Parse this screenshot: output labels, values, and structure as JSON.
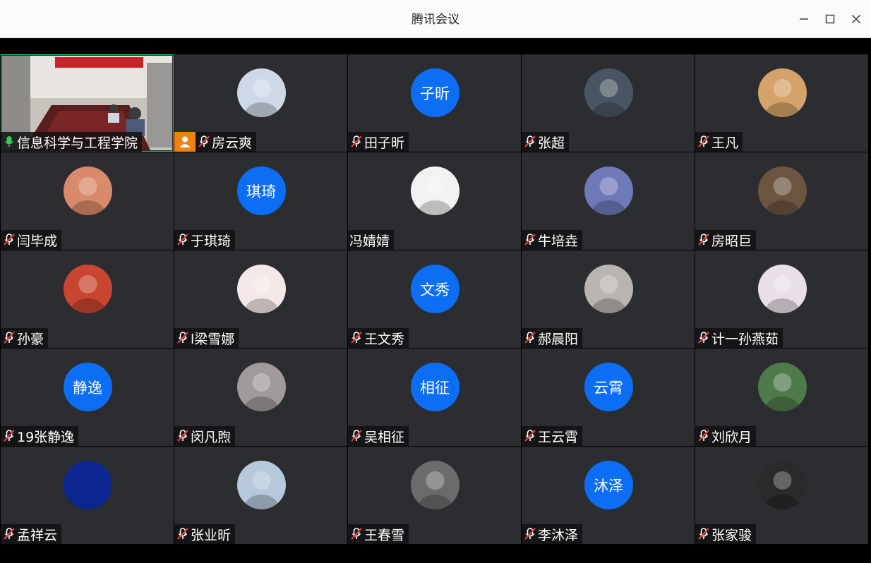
{
  "window": {
    "title": "腾讯会议",
    "controls": [
      "minimize-icon",
      "maximize-icon",
      "close-icon"
    ]
  },
  "participants": [
    {
      "name": "信息科学与工程学院",
      "mic": "on",
      "display": "video",
      "active": true
    },
    {
      "name": "房云爽",
      "mic": "muted",
      "display": "photo",
      "host": true,
      "avatar_color": "#cfd8e6"
    },
    {
      "name": "田子昕",
      "mic": "muted",
      "display": "initials",
      "initials": "子昕"
    },
    {
      "name": "张超",
      "mic": "muted",
      "display": "photo",
      "avatar_color": "#4a5563"
    },
    {
      "name": "王凡",
      "mic": "muted",
      "display": "photo",
      "avatar_color": "#d4a26a"
    },
    {
      "name": "闫毕成",
      "mic": "muted",
      "display": "photo",
      "avatar_color": "#d98a6a"
    },
    {
      "name": "于琪琦",
      "mic": "muted",
      "display": "initials",
      "initials": "琪琦"
    },
    {
      "name": "冯婧婧",
      "mic": "none",
      "display": "photo",
      "avatar_color": "#f2f2f2"
    },
    {
      "name": "牛培垚",
      "mic": "muted",
      "display": "photo",
      "avatar_color": "#6f79b8"
    },
    {
      "name": "房昭巨",
      "mic": "muted",
      "display": "photo",
      "avatar_color": "#6b5540"
    },
    {
      "name": "孙豪",
      "mic": "muted",
      "display": "photo",
      "avatar_color": "#c8452f"
    },
    {
      "name": "l梁雪娜",
      "mic": "muted",
      "display": "photo",
      "avatar_color": "#f5e8e8"
    },
    {
      "name": "王文秀",
      "mic": "muted",
      "display": "initials",
      "initials": "文秀"
    },
    {
      "name": "郝晨阳",
      "mic": "muted",
      "display": "photo",
      "avatar_color": "#b8b4b0"
    },
    {
      "name": "计一孙燕茹",
      "mic": "muted",
      "display": "photo",
      "avatar_color": "#e9dfe6"
    },
    {
      "name": "19张静逸",
      "mic": "muted",
      "display": "initials",
      "initials": "静逸"
    },
    {
      "name": "闵凡煦",
      "mic": "muted",
      "display": "photo",
      "avatar_color": "#a09a9a"
    },
    {
      "name": "吴相征",
      "mic": "muted",
      "display": "initials",
      "initials": "相征"
    },
    {
      "name": "王云霄",
      "mic": "muted",
      "display": "initials",
      "initials": "云霄"
    },
    {
      "name": "刘欣月",
      "mic": "muted",
      "display": "photo",
      "avatar_color": "#4f7a4a"
    },
    {
      "name": "孟祥云",
      "mic": "muted",
      "display": "solid",
      "avatar_color": "#0b2690"
    },
    {
      "name": "张业昕",
      "mic": "muted",
      "display": "photo",
      "avatar_color": "#b5c8dc"
    },
    {
      "name": "王春雪",
      "mic": "muted",
      "display": "photo",
      "avatar_color": "#6b6b6b"
    },
    {
      "name": "李沐泽",
      "mic": "muted",
      "display": "initials",
      "initials": "沐泽"
    },
    {
      "name": "张家骏",
      "mic": "muted",
      "display": "photo",
      "avatar_color": "#2a2a2a"
    }
  ],
  "colors": {
    "tile_bg": "#2b2d31",
    "initials_bg": "#0b6ef4",
    "active_outline": "#2fbf71",
    "mic_muted": "#e0403a",
    "host_badge": "#f2820f"
  }
}
